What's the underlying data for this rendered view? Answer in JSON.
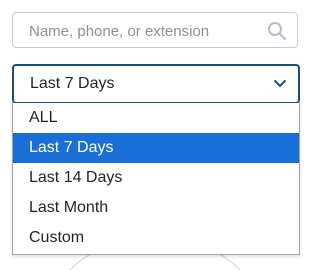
{
  "search": {
    "placeholder": "Name, phone, or extension",
    "icon": "search-icon"
  },
  "date_filter": {
    "selected_label": "Last 7 Days",
    "icon": "chevron-down-icon",
    "options": [
      {
        "label": "ALL",
        "selected": false
      },
      {
        "label": "Last 7 Days",
        "selected": true
      },
      {
        "label": "Last 14 Days",
        "selected": false
      },
      {
        "label": "Last Month",
        "selected": false
      },
      {
        "label": "Custom",
        "selected": false
      }
    ]
  },
  "colors": {
    "accent": "#1a6fd6",
    "select_border": "#1a4c7c",
    "chevron": "#1a4c7c",
    "search_icon": "#b7bcc4"
  }
}
